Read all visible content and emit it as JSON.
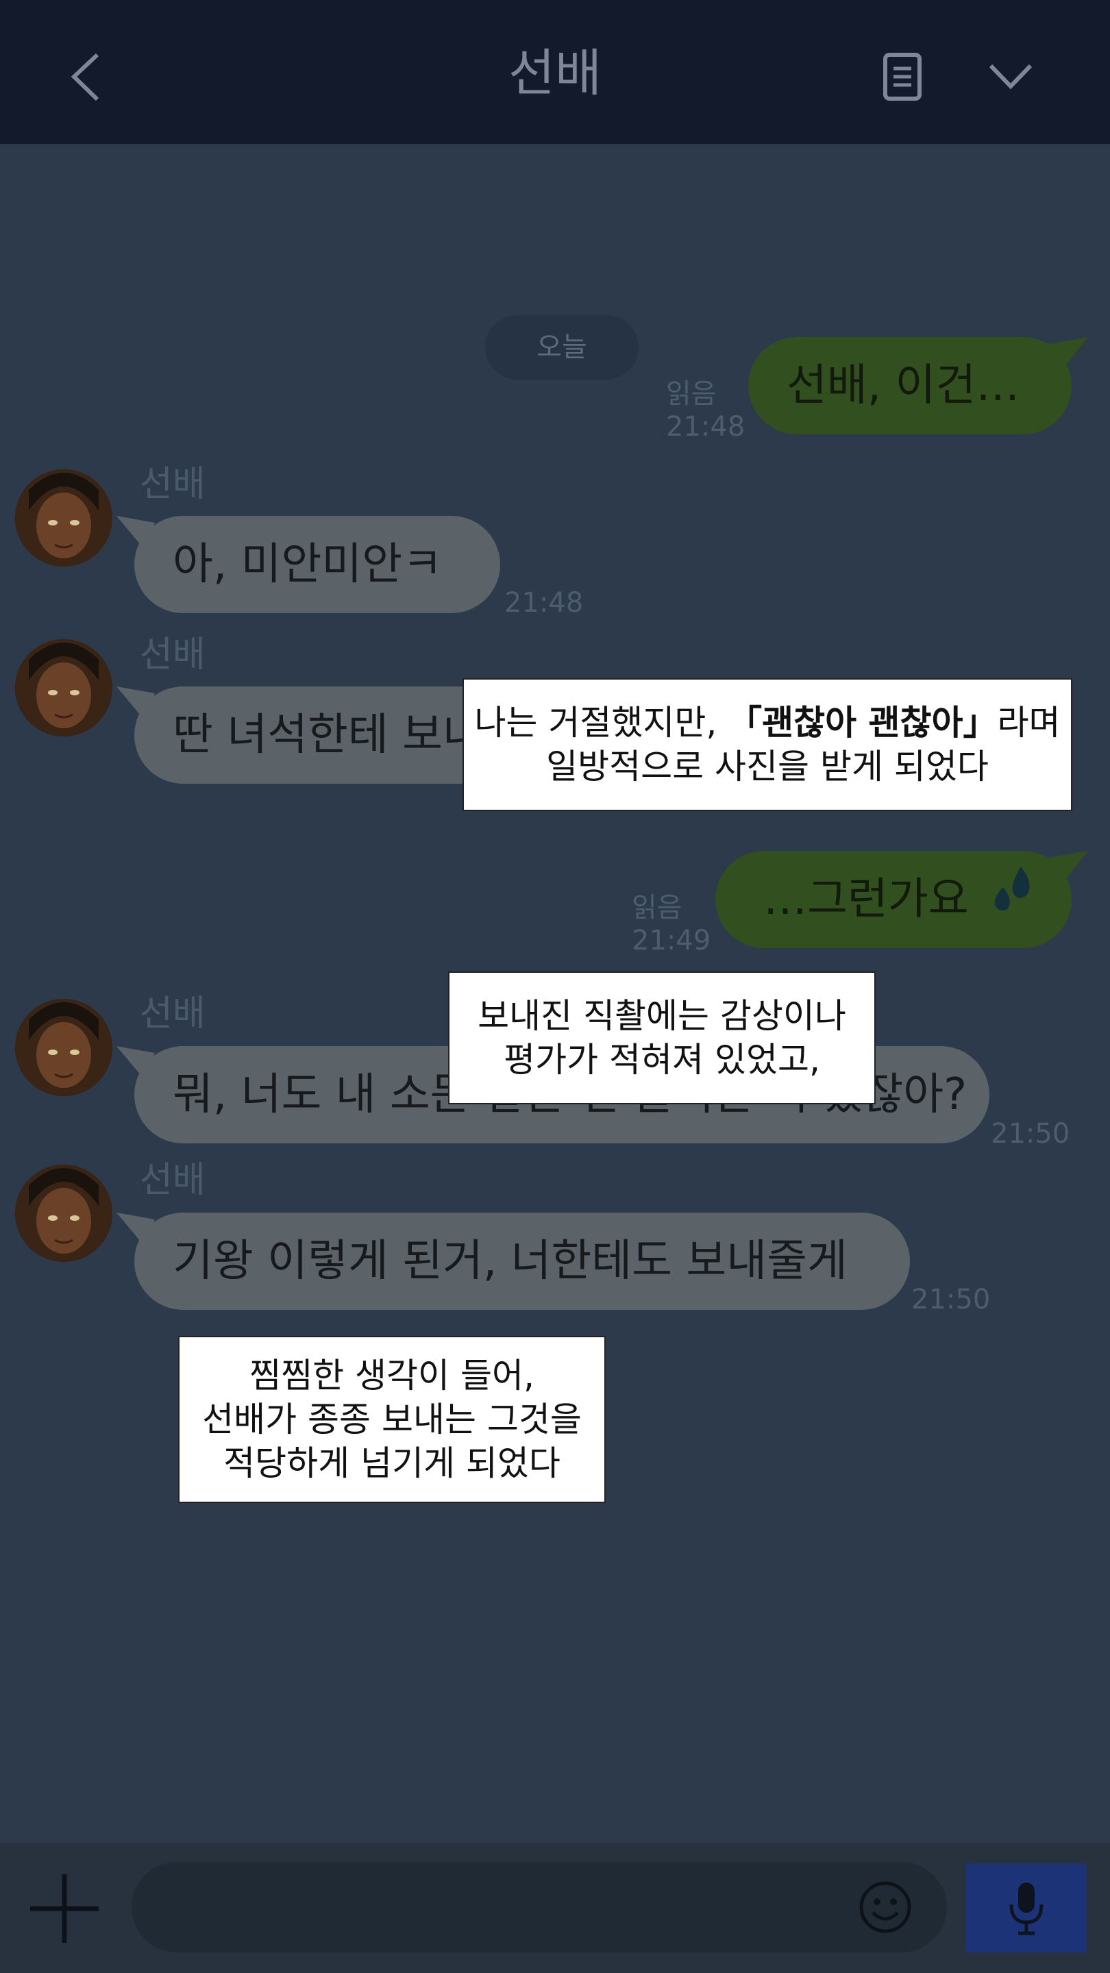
{
  "header": {
    "title": "선배",
    "back_icon": "chevron-left-icon",
    "menu_icon": "document-icon",
    "expand_icon": "chevron-down-icon"
  },
  "chat": {
    "date_divider": "오늘",
    "messages": [
      {
        "direction": "out",
        "text": "선배, 이건…",
        "read": "읽음",
        "time": "21:48"
      },
      {
        "direction": "in",
        "sender": "선배",
        "text": "아, 미안미안ㅋ",
        "time": "21:48"
      },
      {
        "direction": "in",
        "sender": "선배",
        "text": "딴 녀석한테 보내"
      },
      {
        "direction": "out",
        "text": "…그런가요",
        "emoji": "sweat-drops-icon",
        "read": "읽음",
        "time": "21:49"
      },
      {
        "direction": "in",
        "sender": "선배",
        "text": "뭐, 너도 내 소문 같은 건 들어본 적 있잖아?",
        "time": "21:50"
      },
      {
        "direction": "in",
        "sender": "선배",
        "text": "기왕 이렇게 된거, 너한테도 보내줄게",
        "time": "21:50"
      }
    ]
  },
  "captions": {
    "c1_pre": "나는 거절했지만, ",
    "c1_bold": "「괜찮아 괜찮아」",
    "c1_post": "라며",
    "c1_line2": "일방적으로 사진을 받게 되었다",
    "c2_line1": "보내진 직촬에는 감상이나",
    "c2_line2": "평가가 적혀져 있었고,",
    "c3_line1": "찜찜한 생각이 들어,",
    "c3_line2": "선배가 종종 보내는 그것을",
    "c3_line3": "적당하게 넘기게 되었다"
  },
  "input": {
    "add_icon": "plus-icon",
    "emoji_icon": "smiley-icon",
    "mic_icon": "microphone-icon"
  },
  "colors": {
    "header_bg": "#121a2c",
    "chat_bg": "#2c3a4c",
    "outgoing_bubble": "#324f1f",
    "incoming_bubble": "#5b6268",
    "mic_button": "#1d3378"
  }
}
